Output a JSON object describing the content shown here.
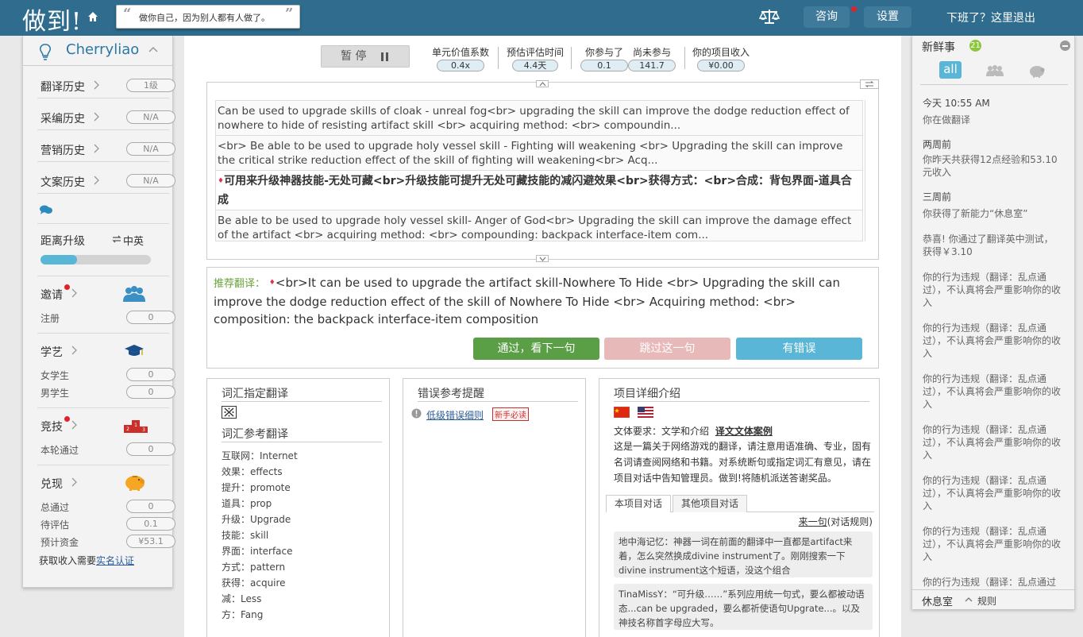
{
  "app": {
    "logo": "做到!",
    "quote": "做你自己，因为别人都有人做了。"
  },
  "topbar": {
    "consult_label": "咨询",
    "settings_label": "设置",
    "logout_text": "下班了？这里退出"
  },
  "left": {
    "username": "Cherryliao",
    "history": [
      {
        "label": "翻译历史",
        "value": "1级"
      },
      {
        "label": "采编历史",
        "value": "N/A"
      },
      {
        "label": "营销历史",
        "value": "N/A"
      },
      {
        "label": "文案历史",
        "value": "N/A"
      }
    ],
    "upgrade_label": "距离升级",
    "lang_pair": "中英",
    "upgrade_progress": 0.33,
    "invite": {
      "label": "邀请",
      "sub_label": "注册",
      "sub_value": "0"
    },
    "study": {
      "label": "学艺",
      "female_label": "女学生",
      "female_value": "0",
      "male_label": "男学生",
      "male_value": "0"
    },
    "compete": {
      "label": "竞技",
      "round_label": "本轮通过",
      "round_value": "0"
    },
    "cashout": {
      "label": "兑现",
      "total_label": "总通过",
      "total_value": "0",
      "pending_label": "待评估",
      "pending_value": "0.1",
      "est_label": "预计资金",
      "est_value": "¥53.1"
    },
    "footer_text": "获取收入需要",
    "footer_link": "实名认证"
  },
  "toolbar": {
    "pause_label": "暂 停",
    "stats": [
      {
        "label": "单元价值系数",
        "value": "0.4x"
      },
      {
        "label": "预估评估时间",
        "value": "4.4天"
      },
      {
        "label": "你参与了",
        "value": "0.1"
      },
      {
        "label": "尚未参与",
        "value": "141.7"
      },
      {
        "label": "你的项目收入",
        "value": "¥0.00"
      }
    ]
  },
  "source": {
    "items": [
      "Can be used to upgrade skills of cloak - unreal fog<br> upgrading the skill can improve the dodge reduction effect of nowhere to hide of resisting artifact skill <br> acquiring method: <br> compoundin...",
      "<br> Be able to be used to upgrade holy vessel skill - Fighting will weakening <br> Upgrading the skill can improve the critical strike reduction effect of the skill of fighting will weakening<br> Acq...",
      "可用来升级神器技能-无处可藏<br>升级技能可提升无处可藏技能的减闪避效果<br>获得方式：<br>合成：背包界面-道具合成",
      "Be able to be used to upgrade holy vessel skill- Anger of God<br> Upgrading the skill can improve the damage effect of the artifact <br> acquiring method: <br> compounding: backpack interface-item com..."
    ]
  },
  "recommend": {
    "label": "推荐翻译：",
    "text": "<br>It can be used to upgrade the artifact skill-Nowhere To Hide <br> Upgrading the skill can improve the dodge reduction effect of the skill of Nowhere To Hide <br> Acquiring method: <br> composition: the backpack interface-item composition",
    "pass_label": "通过，看下一句",
    "skip_label": "跳过这一句",
    "error_label": "有错误"
  },
  "glossary": {
    "title": "词汇指定翻译",
    "ref_title": "词汇参考翻译",
    "items": [
      "互联网：Internet",
      "效果：effects",
      "提升：promote",
      "道具：prop",
      "升级：Upgrade",
      "技能：skill",
      "界面：interface",
      "方式：pattern",
      "获得：acquire",
      "减：Less",
      "方：Fang"
    ]
  },
  "errors": {
    "title": "错误参考提醒",
    "link": "低级错误细则",
    "badge": "新手必读"
  },
  "project": {
    "title": "项目详细介绍",
    "req_label": "文体要求：文学和介绍",
    "req_link": "译文文体案例",
    "desc": "这是一篇关于网络游戏的翻译，请注意用语准确、专业，固有名词请查阅网络和书籍。对系统断句或指定词汇有意见，请在项目对话中告知管理员。做到!将随机派送答谢奖品。",
    "tab1": "本项目对话",
    "tab2": "其他项目对话",
    "next_link": "来一句",
    "rules_text": "(对话规则)",
    "comments": [
      "地中海记忆：神器一词在前面的翻译中一直都是artifact来着，怎么突然换成divine instrument了。刚刚搜索一下divine instrument这个短语，没这个组合",
      "TinaMissY：“可升级……”系列应用统一句式，要么都被动语态...can be upgraded，要么都祈使语句Upgrate...。以及神技名称首字母应大写。"
    ]
  },
  "news": {
    "title": "新鲜事",
    "badge": "21",
    "all_label": "all",
    "entries": [
      {
        "date": "今天 10:55 AM",
        "text": "你在做翻译"
      },
      {
        "date": "两周前",
        "text": "你昨天共获得12点经验和53.10元收入"
      },
      {
        "date": "三周前",
        "text": "你获得了新能力“休息室”"
      },
      {
        "date": "",
        "text": "恭喜! 你通过了翻译英中测试，获得￥3.10"
      },
      {
        "date": "",
        "text": "你的行为违规（翻译：乱点通过），不认真将会严重影响你的收入"
      },
      {
        "date": "",
        "text": "你的行为违规（翻译：乱点通过），不认真将会严重影响你的收入"
      },
      {
        "date": "",
        "text": "你的行为违规（翻译：乱点通过），不认真将会严重影响你的收入"
      },
      {
        "date": "",
        "text": "你的行为违规（翻译：乱点通过），不认真将会严重影响你的收入"
      },
      {
        "date": "",
        "text": "你的行为违规（翻译：乱点通过），不认真将会严重影响你的收入"
      },
      {
        "date": "",
        "text": "你的行为违规（翻译：乱点通过），不认真将会严重影响你的收入"
      },
      {
        "date": "",
        "text": "你的行为违规（翻译：乱点通过"
      }
    ],
    "rest_label": "休息室",
    "rules_label": "规则"
  },
  "colors": {
    "topbar": "#2f6c8e",
    "accent": "#59b6d6",
    "pass": "#5a9e46",
    "skip": "#e8b9b9",
    "error": "#59b6d6"
  }
}
